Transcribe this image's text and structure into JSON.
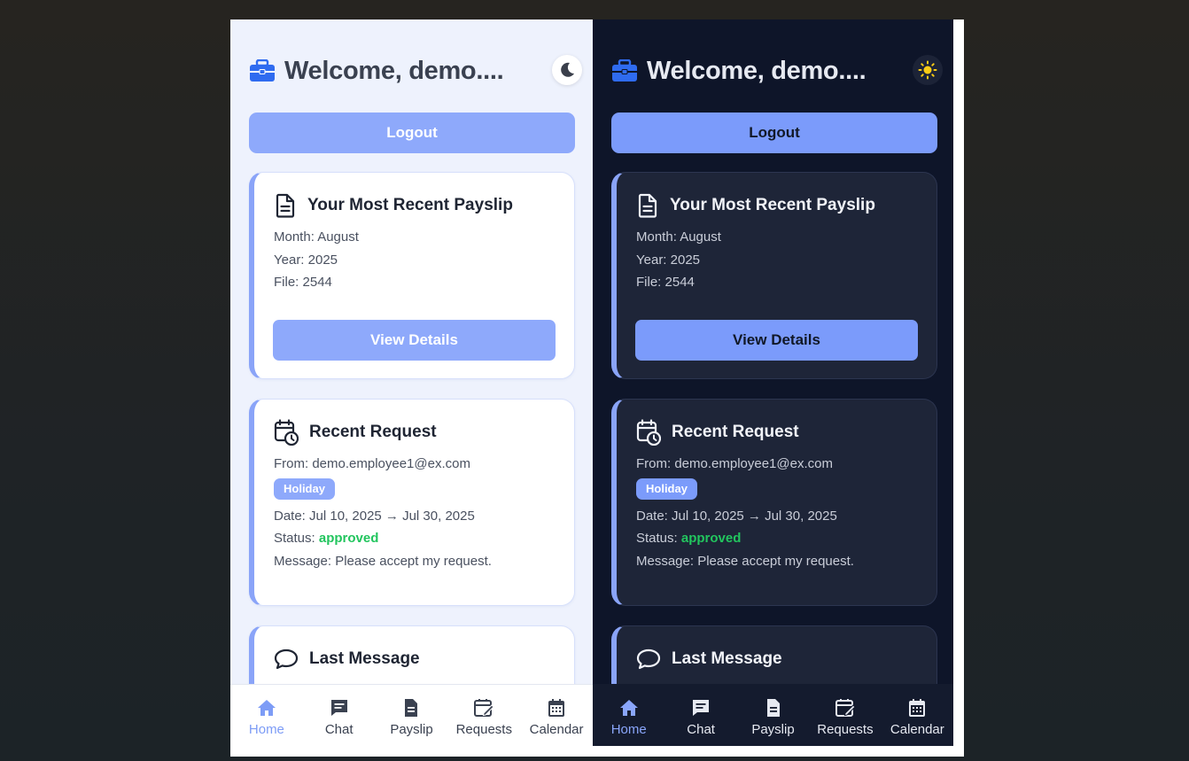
{
  "header": {
    "welcome": "Welcome, demo...."
  },
  "logout_label": "Logout",
  "payslip": {
    "title": "Your Most Recent Payslip",
    "month": "Month: August",
    "year": "Year: 2025",
    "file": "File: 2544",
    "view_label": "View Details"
  },
  "request": {
    "title": "Recent Request",
    "from": "From: demo.employee1@ex.com",
    "type": "Holiday",
    "date": "Date: Jul 10, 2025 → Jul 30, 2025",
    "status_label": "Status: ",
    "status_value": "approved",
    "message": "Message: Please accept my request."
  },
  "last_message": {
    "title": "Last Message"
  },
  "nav": {
    "home": "Home",
    "chat": "Chat",
    "payslip": "Payslip",
    "requests": "Requests",
    "calendar": "Calendar"
  },
  "icons": {
    "header": "briefcase-icon",
    "light_theme_toggle": "moon-icon",
    "dark_theme_toggle": "sun-icon",
    "payslip": "document-icon",
    "request": "calendar-clock-icon",
    "message": "chat-bubble-icon"
  },
  "colors": {
    "accent": "#8ea9fb",
    "accent_dark_mode": "#7b9bfb",
    "card_stripe": "#8aa4f8",
    "approved": "#22c55e",
    "brand_blue": "#2f6bf0",
    "light_bg": "#eef2fd",
    "dark_bg": "#0e1529"
  }
}
